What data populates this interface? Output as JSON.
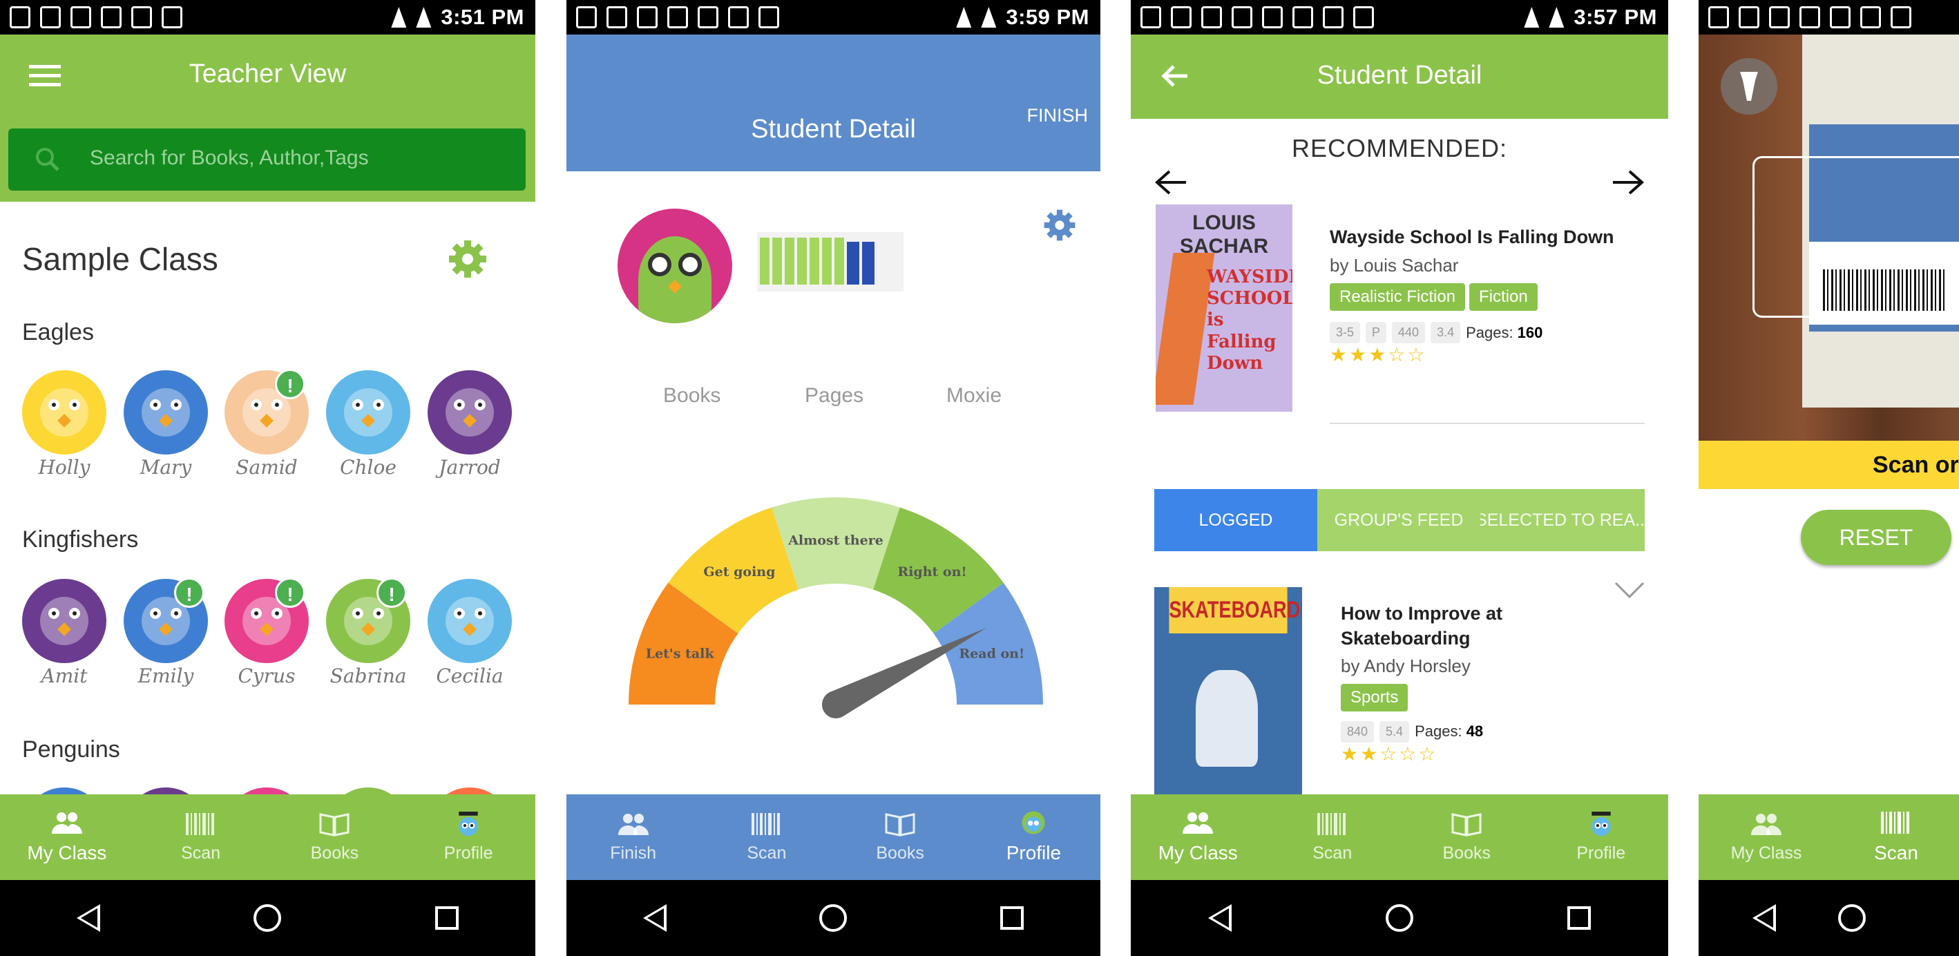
{
  "status": {
    "p1_time": "3:51 PM",
    "p2_time": "3:59 PM",
    "p3_time": "3:57 PM"
  },
  "screen1": {
    "title": "Teacher View",
    "search_placeholder": "Search for Books, Author,Tags",
    "class_name": "Sample Class",
    "groups": [
      {
        "name": "Eagles",
        "students": [
          "Holly",
          "Mary",
          "Samid",
          "Chloe",
          "Jarrod"
        ]
      },
      {
        "name": "Kingfishers",
        "students": [
          "Amit",
          "Emily",
          "Cyrus",
          "Sabrina",
          "Cecilia"
        ]
      },
      {
        "name": "Penguins",
        "students": []
      }
    ],
    "badge_text": "!",
    "nav": [
      "My Class",
      "Scan",
      "Books",
      "Profile"
    ]
  },
  "screen2": {
    "title": "Student Detail",
    "finish_label": "FINISH",
    "stats": [
      "Books",
      "Pages",
      "Moxie"
    ],
    "gauge": {
      "segments": [
        "Let's talk",
        "Get going",
        "Almost there",
        "Right on!",
        "Read on!"
      ],
      "level": 0.85
    },
    "nav": [
      "Finish",
      "Scan",
      "Books",
      "Profile"
    ]
  },
  "screen3": {
    "title": "Student Detail",
    "recommended_label": "RECOMMENDED:",
    "book1": {
      "title": "Wayside School Is Falling Down",
      "author": "by Louis Sachar",
      "tags": [
        "Realistic Fiction",
        "Fiction"
      ],
      "chips": [
        "3-5",
        "P",
        "440",
        "3.4"
      ],
      "pages_label": "Pages:",
      "pages": "160",
      "rating": 3,
      "cover_author": "LOUIS SACHAR",
      "cover_title": "WAYSIDE SCHOOL is Falling Down"
    },
    "tabs": [
      "LOGGED",
      "GROUP'S FEED",
      "SELECTED TO REA..."
    ],
    "book2": {
      "title": "How to Improve at Skateboarding",
      "author": "by Andy Horsley",
      "tags": [
        "Sports"
      ],
      "chips": [
        "840",
        "5.4"
      ],
      "pages_label": "Pages:",
      "pages": "48",
      "rating": 2,
      "cover_title": "SKATEBOARDING"
    },
    "nav": [
      "My Class",
      "Scan",
      "Books",
      "Profile"
    ]
  },
  "screen4": {
    "banner": "Scan or Se",
    "reset_label": "RESET",
    "nav": [
      "My Class",
      "Scan"
    ]
  },
  "colors": {
    "green": "#8bc34a",
    "dark_green": "#138a1e",
    "blue": "#5c8ccb",
    "tab_blue": "#3d85e8",
    "yellow": "#fdd835"
  }
}
